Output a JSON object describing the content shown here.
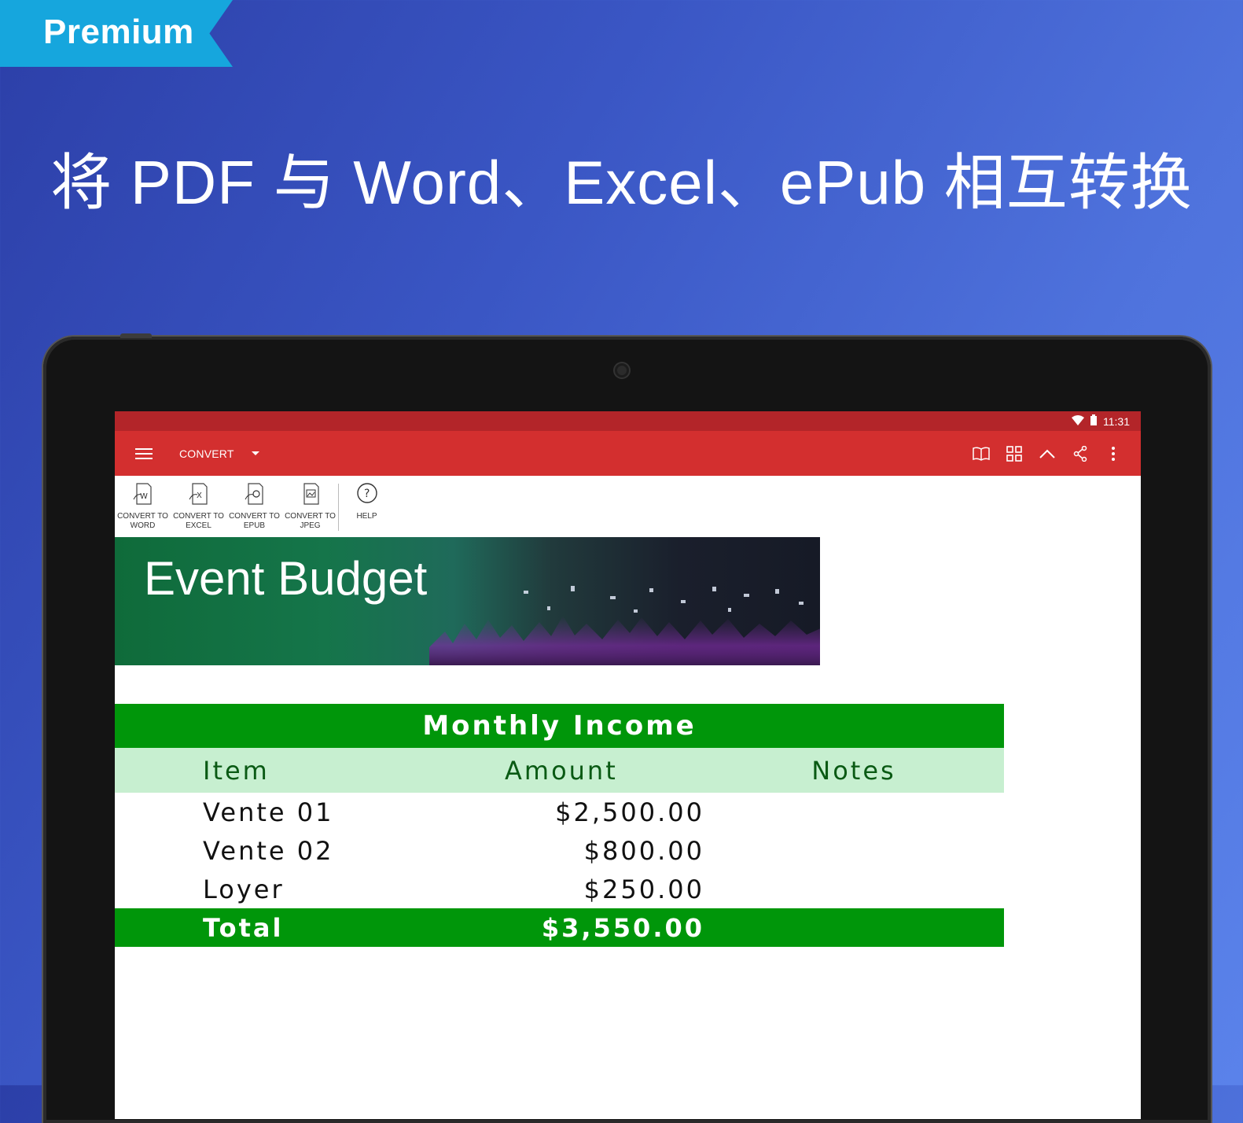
{
  "promo": {
    "badge": "Premium",
    "headline": "将 PDF 与 Word、Excel、ePub 相互转换"
  },
  "statusbar": {
    "time": "11:31"
  },
  "appbar": {
    "mode": "CONVERT",
    "actions": [
      "book-icon",
      "grid-icon",
      "chevron-up-icon",
      "share-icon",
      "more-vert-icon"
    ]
  },
  "toolbar": {
    "items": [
      {
        "label": "CONVERT TO\nWORD",
        "icon": "word-convert-icon"
      },
      {
        "label": "CONVERT TO\nEXCEL",
        "icon": "excel-convert-icon"
      },
      {
        "label": "CONVERT TO\nEPUB",
        "icon": "epub-convert-icon"
      },
      {
        "label": "CONVERT TO\nJPEG",
        "icon": "jpeg-convert-icon"
      },
      {
        "label": "HELP",
        "icon": "help-icon"
      }
    ]
  },
  "document": {
    "banner_title": "Event Budget",
    "table": {
      "title": "Monthly Income",
      "columns": [
        "Item",
        "Amount",
        "Notes"
      ],
      "rows": [
        {
          "item": "Vente 01",
          "amount": "$2,500.00",
          "notes": ""
        },
        {
          "item": "Vente 02",
          "amount": "$800.00",
          "notes": ""
        },
        {
          "item": "Loyer",
          "amount": "$250.00",
          "notes": ""
        }
      ],
      "total": {
        "label": "Total",
        "amount": "$3,550.00"
      }
    }
  },
  "colors": {
    "ribbon": "#16a6dd",
    "appbar": "#d32f2f",
    "statusbar": "#b32529",
    "table_header": "#00960a",
    "column_header": "#c7efd0"
  }
}
